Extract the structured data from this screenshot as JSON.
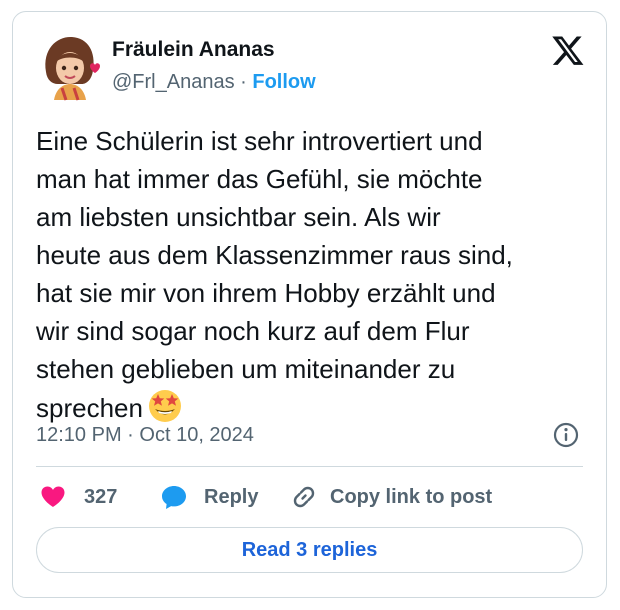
{
  "author": {
    "name": "Fräulein Ananas",
    "handle": "@Frl_Ananas",
    "separator": "·",
    "follow_label": "Follow"
  },
  "platform_icon": "x-logo-icon",
  "tweet": {
    "lines": [
      "Eine Schülerin ist sehr introvertiert und",
      "man hat immer das Gefühl, sie möchte",
      "am liebsten unsichtbar sein. Als wir",
      "heute aus dem Klassenzimmer raus sind,",
      "hat sie mir von ihrem Hobby erzählt und",
      "wir sind sogar noch kurz auf dem Flur",
      "stehen geblieben um miteinander zu",
      "sprechen"
    ],
    "emoji": "star-struck-emoji-icon"
  },
  "meta": {
    "time": "12:10 PM",
    "separator": "·",
    "date": "Oct 10, 2024",
    "info_icon": "info-icon"
  },
  "actions": {
    "like_count": "327",
    "reply_label": "Reply",
    "copy_label": "Copy link to post"
  },
  "read_replies_label": "Read 3 replies",
  "colors": {
    "accent": "#1d9bf0",
    "like": "#f91880",
    "reply": "#1d9bf0",
    "text_secondary": "#536471",
    "border": "#cfd9de"
  }
}
